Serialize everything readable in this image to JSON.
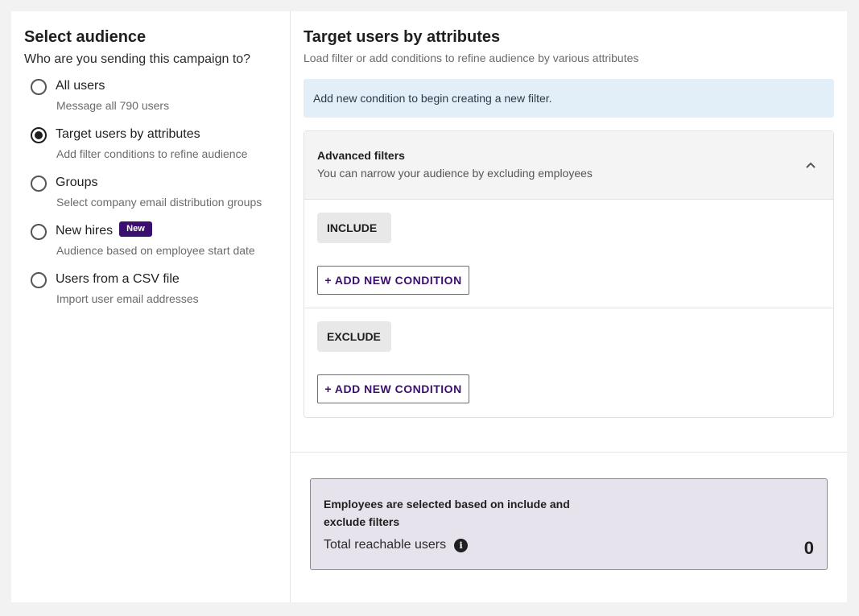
{
  "audience": {
    "title": "Select audience",
    "subtitle": "Who are you sending this campaign to?",
    "options": [
      {
        "label": "All users",
        "description": "Message all 790 users",
        "selected": false
      },
      {
        "label": "Target users by attributes",
        "description": "Add filter conditions to refine audience",
        "selected": true
      },
      {
        "label": "Groups",
        "description": "Select company email distribution groups",
        "selected": false
      },
      {
        "label": "New hires",
        "description": "Audience based on employee start date",
        "selected": false,
        "badge": "New"
      },
      {
        "label": "Users from a CSV file",
        "description": "Import user email addresses",
        "selected": false
      }
    ]
  },
  "target": {
    "title": "Target users by attributes",
    "subtitle": "Load filter or add conditions to refine audience by various attributes",
    "banner": "Add new condition to begin creating a new filter."
  },
  "advanced": {
    "title": "Advanced filters",
    "description": "You can narrow your audience by excluding employees",
    "include_label": "INCLUDE",
    "exclude_label": "EXCLUDE",
    "add_condition_label": "+ ADD NEW CONDITION"
  },
  "summary": {
    "title": "Employees are selected based on include and exclude filters",
    "reach_label": "Total reachable users",
    "reach_count": "0"
  },
  "colors": {
    "brand": "#3b0f6e",
    "banner_bg": "#e3eff8",
    "summary_bg": "#e6e3ec"
  }
}
